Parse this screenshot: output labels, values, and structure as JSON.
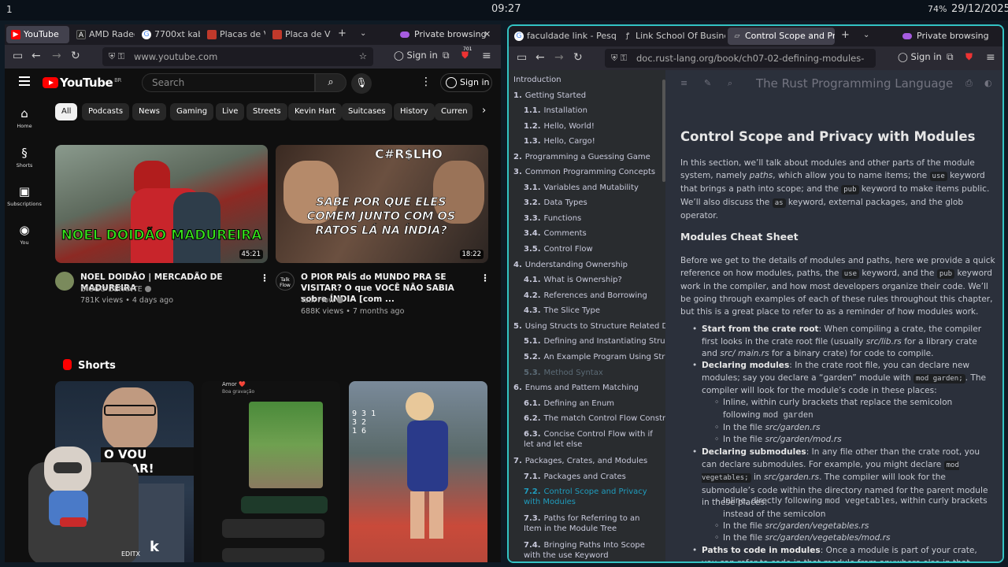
{
  "system": {
    "workspace": "1",
    "clock": "09:27",
    "battery": "74%",
    "date": "29/12/2025"
  },
  "left_window": {
    "tabs": [
      {
        "label": "YouTube",
        "icon": "youtube-favicon",
        "color": "#ff0000"
      },
      {
        "label": "AMD Radeo",
        "icon": "amd-favicon",
        "color": "#333333"
      },
      {
        "label": "7700xt kab",
        "icon": "google-favicon",
        "color": "#4285f4"
      },
      {
        "label": "Placas de V",
        "icon": "page-favicon",
        "color": "#c0392b"
      },
      {
        "label": "Placa de Vi",
        "icon": "page-favicon",
        "color": "#c0392b"
      }
    ],
    "private_label": "Private browsing",
    "url": "www.youtube.com",
    "signin": "Sign in",
    "ext_badge": "701",
    "youtube": {
      "logo": "YouTube",
      "country": "BR",
      "search_placeholder": "Search",
      "signin": "Sign in",
      "sidebar": [
        {
          "label": "Home",
          "icon": "home-icon",
          "glyph": "⌂"
        },
        {
          "label": "Shorts",
          "icon": "shorts-icon",
          "glyph": "§"
        },
        {
          "label": "Subscriptions",
          "icon": "subscriptions-icon",
          "glyph": "▣"
        },
        {
          "label": "You",
          "icon": "you-icon",
          "glyph": "◉"
        }
      ],
      "chips": [
        "All",
        "Podcasts",
        "News",
        "Gaming",
        "Live",
        "Streets",
        "Kevin Hart",
        "Suitcases",
        "History",
        "Curren"
      ],
      "videos": [
        {
          "title": "NOEL DOIDÃO | MERCADÃO DE MADUREIRA",
          "channel": "DIOGO DEFANTE",
          "meta": "781K views • 4 days ago",
          "duration": "45:21",
          "overlay": "NOEL DOIDÃO MADUREIRA"
        },
        {
          "title": "O PIOR PAÍS do MUNDO PRA SE VISITAR? O que VOCÊ NÃO SABIA sobre ÍNDIA [com ...",
          "channel": "Talk Flow",
          "meta": "688K views • 7 months ago",
          "duration": "18:22",
          "overlay_top": "C#R$LHO",
          "overlay": "SABE POR QUE ELES COMEM JUNTO COM OS RATOS LÁ NA ÍNDIA?",
          "channel_badge": "Talk Flow"
        }
      ],
      "shorts_title": "Shorts",
      "shorts": [
        {
          "overlay": "O VOU PAGAR!",
          "overlay2": "k",
          "watermark": "EDITX"
        },
        {
          "overlay": "Amor ❤️",
          "overlay2": "Boa gravação"
        },
        {
          "overlay": ""
        }
      ]
    }
  },
  "right_window": {
    "tabs": [
      {
        "label": "faculdade link - Pesq",
        "icon": "google-favicon",
        "color": "#4285f4"
      },
      {
        "label": "Link School Of Busine",
        "icon": "link-favicon",
        "color": "#1a73e8"
      },
      {
        "label": "Control Scope and Pr",
        "icon": "book-favicon",
        "color": "#aaaaaa"
      }
    ],
    "private_label": "Private browsing",
    "url": "doc.rust-lang.org/book/ch07-02-defining-modules-",
    "signin": "Sign in",
    "book": {
      "title": "The Rust Programming Language",
      "toc": [
        {
          "num": "",
          "label": "Introduction",
          "level": 0
        },
        {
          "num": "1.",
          "label": "Getting Started",
          "level": 0
        },
        {
          "num": "1.1.",
          "label": "Installation",
          "level": 1
        },
        {
          "num": "1.2.",
          "label": "Hello, World!",
          "level": 1
        },
        {
          "num": "1.3.",
          "label": "Hello, Cargo!",
          "level": 1
        },
        {
          "num": "2.",
          "label": "Programming a Guessing Game",
          "level": 0
        },
        {
          "num": "3.",
          "label": "Common Programming Concepts",
          "level": 0
        },
        {
          "num": "3.1.",
          "label": "Variables and Mutability",
          "level": 1
        },
        {
          "num": "3.2.",
          "label": "Data Types",
          "level": 1
        },
        {
          "num": "3.3.",
          "label": "Functions",
          "level": 1
        },
        {
          "num": "3.4.",
          "label": "Comments",
          "level": 1
        },
        {
          "num": "3.5.",
          "label": "Control Flow",
          "level": 1
        },
        {
          "num": "4.",
          "label": "Understanding Ownership",
          "level": 0
        },
        {
          "num": "4.1.",
          "label": "What is Ownership?",
          "level": 1
        },
        {
          "num": "4.2.",
          "label": "References and Borrowing",
          "level": 1
        },
        {
          "num": "4.3.",
          "label": "The Slice Type",
          "level": 1
        },
        {
          "num": "5.",
          "label": "Using Structs to Structure Related Data",
          "level": 0
        },
        {
          "num": "5.1.",
          "label": "Defining and Instantiating Structs",
          "level": 1
        },
        {
          "num": "5.2.",
          "label": "An Example Program Using Structs",
          "level": 1
        },
        {
          "num": "5.3.",
          "label": "Method Syntax",
          "level": 1
        },
        {
          "num": "6.",
          "label": "Enums and Pattern Matching",
          "level": 0
        },
        {
          "num": "6.1.",
          "label": "Defining an Enum",
          "level": 1
        },
        {
          "num": "6.2.",
          "label": "The match Control Flow Construct",
          "level": 1
        },
        {
          "num": "6.3.",
          "label": "Concise Control Flow with if let and let else",
          "level": 1
        },
        {
          "num": "7.",
          "label": "Packages, Crates, and Modules",
          "level": 0
        },
        {
          "num": "7.1.",
          "label": "Packages and Crates",
          "level": 1
        },
        {
          "num": "7.2.",
          "label": "Control Scope and Privacy with Modules",
          "level": 1
        },
        {
          "num": "7.3.",
          "label": "Paths for Referring to an Item in the Module Tree",
          "level": 1
        },
        {
          "num": "7.4.",
          "label": "Bringing Paths Into Scope with the use Keyword",
          "level": 1
        }
      ],
      "h1": "Control Scope and Privacy with Modules",
      "h2": "Modules Cheat Sheet"
    }
  },
  "colors": {
    "accent_teal": "#33c4c4",
    "rust_link": "#1f9cbd",
    "yt_red": "#ff0000"
  }
}
